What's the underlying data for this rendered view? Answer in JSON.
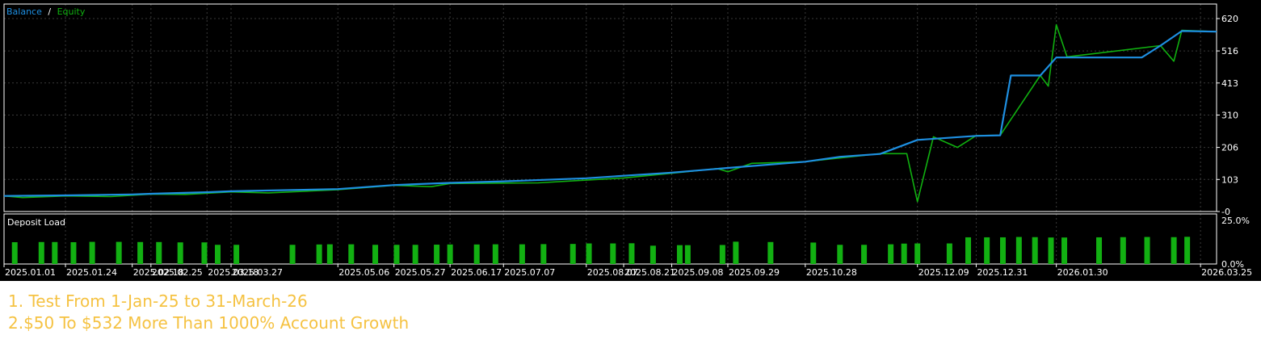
{
  "colors": {
    "background": "#000000",
    "frame": "#ffffff",
    "grid": "#3a3a3a",
    "text": "#ffffff",
    "balance": "#1e8fe1",
    "equity": "#10b010",
    "deposit_load": "#12b012",
    "caption": "#f5c242"
  },
  "chart_data": [
    {
      "type": "line",
      "legend": {
        "items": [
          "Balance",
          "Equity"
        ],
        "separator": "/",
        "placement": "top-left"
      },
      "y_ticks": [
        "620",
        "516",
        "413",
        "310",
        "206",
        "103",
        "-0"
      ],
      "ylim": [
        0,
        620
      ],
      "grid": true,
      "xlim": [
        "2025-01-01",
        "2026-03-31"
      ],
      "series": [
        {
          "name": "Balance",
          "points": [
            [
              "2025-01-01",
              50
            ],
            [
              "2025-01-24",
              52
            ],
            [
              "2025-02-18",
              55
            ],
            [
              "2025-02-25",
              57
            ],
            [
              "2025-03-18",
              62
            ],
            [
              "2025-03-27",
              65
            ],
            [
              "2025-05-06",
              72
            ],
            [
              "2025-05-27",
              85
            ],
            [
              "2025-06-17",
              92
            ],
            [
              "2025-07-07",
              97
            ],
            [
              "2025-08-07",
              107
            ],
            [
              "2025-08-21",
              115
            ],
            [
              "2025-09-08",
              125
            ],
            [
              "2025-09-29",
              140
            ],
            [
              "2025-10-28",
              160
            ],
            [
              "2025-11-10",
              176
            ],
            [
              "2025-11-25",
              185
            ],
            [
              "2025-12-09",
              230
            ],
            [
              "2025-12-31",
              243
            ],
            [
              "2026-01-09",
              245
            ],
            [
              "2026-01-13",
              437
            ],
            [
              "2026-01-24",
              437
            ],
            [
              "2026-01-30",
              495
            ],
            [
              "2026-03-03",
              495
            ],
            [
              "2026-03-10",
              533
            ],
            [
              "2026-03-18",
              580
            ],
            [
              "2026-03-31",
              578
            ]
          ]
        },
        {
          "name": "Equity",
          "points": [
            [
              "2025-01-01",
              50
            ],
            [
              "2025-01-08",
              45
            ],
            [
              "2025-01-24",
              50
            ],
            [
              "2025-02-10",
              48
            ],
            [
              "2025-02-25",
              56
            ],
            [
              "2025-03-10",
              55
            ],
            [
              "2025-03-27",
              63
            ],
            [
              "2025-04-10",
              60
            ],
            [
              "2025-05-06",
              70
            ],
            [
              "2025-05-27",
              84
            ],
            [
              "2025-06-10",
              80
            ],
            [
              "2025-06-17",
              90
            ],
            [
              "2025-07-20",
              92
            ],
            [
              "2025-08-07",
              101
            ],
            [
              "2025-08-21",
              108
            ],
            [
              "2025-09-08",
              123
            ],
            [
              "2025-09-25",
              138
            ],
            [
              "2025-09-29",
              128
            ],
            [
              "2025-10-08",
              155
            ],
            [
              "2025-10-28",
              160
            ],
            [
              "2025-11-25",
              186
            ],
            [
              "2025-12-05",
              186
            ],
            [
              "2025-12-09",
              32
            ],
            [
              "2025-12-15",
              240
            ],
            [
              "2025-12-24",
              206
            ],
            [
              "2025-12-31",
              244
            ],
            [
              "2026-01-09",
              245
            ],
            [
              "2026-01-24",
              437
            ],
            [
              "2026-01-27",
              403
            ],
            [
              "2026-01-30",
              600
            ],
            [
              "2026-02-03",
              497
            ],
            [
              "2026-03-10",
              533
            ],
            [
              "2026-03-15",
              483
            ],
            [
              "2026-03-18",
              582
            ],
            [
              "2026-03-31",
              578
            ]
          ]
        }
      ]
    },
    {
      "type": "bar",
      "title": "Deposit Load",
      "y_ticks": [
        "25.0%",
        "0.0%"
      ],
      "ylim": [
        0,
        25
      ],
      "bars": [
        [
          "2025-01-05",
          12.5
        ],
        [
          "2025-01-15",
          12.6
        ],
        [
          "2025-01-20",
          12.6
        ],
        [
          "2025-01-27",
          12.5
        ],
        [
          "2025-02-03",
          12.7
        ],
        [
          "2025-02-13",
          12.7
        ],
        [
          "2025-02-21",
          12.6
        ],
        [
          "2025-02-28",
          12.6
        ],
        [
          "2025-03-08",
          12.4
        ],
        [
          "2025-03-17",
          12.4
        ],
        [
          "2025-03-22",
          11.0
        ],
        [
          "2025-03-29",
          11.0
        ],
        [
          "2025-04-19",
          11.0
        ],
        [
          "2025-04-29",
          11.2
        ],
        [
          "2025-05-03",
          11.3
        ],
        [
          "2025-05-11",
          11.3
        ],
        [
          "2025-05-20",
          11.0
        ],
        [
          "2025-05-28",
          11.0
        ],
        [
          "2025-06-04",
          11.0
        ],
        [
          "2025-06-12",
          11.1
        ],
        [
          "2025-06-17",
          11.2
        ],
        [
          "2025-06-27",
          11.2
        ],
        [
          "2025-07-04",
          11.3
        ],
        [
          "2025-07-14",
          11.3
        ],
        [
          "2025-07-22",
          11.4
        ],
        [
          "2025-08-02",
          11.5
        ],
        [
          "2025-08-08",
          11.8
        ],
        [
          "2025-08-17",
          11.8
        ],
        [
          "2025-08-24",
          11.9
        ],
        [
          "2025-09-01",
          10.5
        ],
        [
          "2025-09-11",
          10.8
        ],
        [
          "2025-09-14",
          10.8
        ],
        [
          "2025-09-27",
          10.9
        ],
        [
          "2025-10-02",
          12.8
        ],
        [
          "2025-10-15",
          12.6
        ],
        [
          "2025-10-31",
          12.3
        ],
        [
          "2025-11-10",
          11.0
        ],
        [
          "2025-11-19",
          11.0
        ],
        [
          "2025-11-29",
          11.3
        ],
        [
          "2025-12-04",
          11.7
        ],
        [
          "2025-12-09",
          11.8
        ],
        [
          "2025-12-21",
          11.8
        ],
        [
          "2025-12-28",
          15.3
        ],
        [
          "2026-01-04",
          15.3
        ],
        [
          "2026-01-10",
          15.3
        ],
        [
          "2026-01-16",
          15.5
        ],
        [
          "2026-01-22",
          15.4
        ],
        [
          "2026-01-28",
          15.2
        ],
        [
          "2026-02-02",
          15.2
        ],
        [
          "2026-02-15",
          15.3
        ],
        [
          "2026-02-24",
          15.4
        ],
        [
          "2026-03-05",
          15.5
        ],
        [
          "2026-03-15",
          15.4
        ],
        [
          "2026-03-20",
          15.6
        ]
      ]
    }
  ],
  "x_tick_labels": [
    "2025.01.01",
    "2025.01.24",
    "2025.02.18",
    "2025.02.25",
    "2025.03.18",
    "2025.03.27",
    "2025.05.06",
    "2025.05.27",
    "2025.06.17",
    "2025.07.07",
    "2025.08.07",
    "2025.08.21",
    "2025.09.08",
    "2025.09.29",
    "2025.10.28",
    "2025.12.09",
    "2025.12.31",
    "2026.01.30",
    "2026.03.25"
  ],
  "caption": {
    "line1": "1. Test From 1-Jan-25 to 31-March-26",
    "line2": "2.$50 To $532 More Than 1000% Account Growth"
  }
}
